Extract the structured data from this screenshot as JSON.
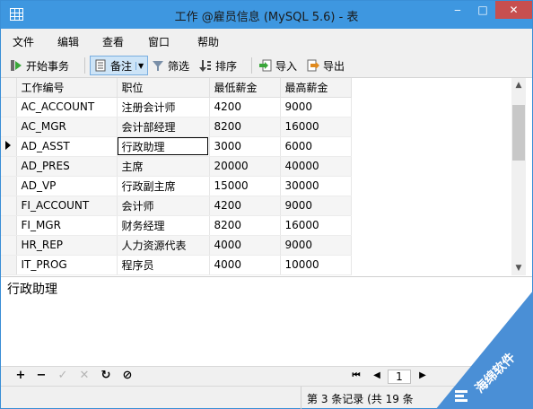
{
  "window": {
    "title": "工作 @雇员信息 (MySQL 5.6) - 表"
  },
  "menu": [
    "文件",
    "编辑",
    "查看",
    "窗口",
    "帮助"
  ],
  "toolbar": {
    "begin_transaction": "开始事务",
    "memo": "备注",
    "filter": "筛选",
    "sort": "排序",
    "import": "导入",
    "export": "导出"
  },
  "table": {
    "columns": [
      "工作编号",
      "职位",
      "最低薪金",
      "最高薪金"
    ],
    "rows": [
      [
        "AC_ACCOUNT",
        "注册会计师",
        "4200",
        "9000"
      ],
      [
        "AC_MGR",
        "会计部经理",
        "8200",
        "16000"
      ],
      [
        "AD_ASST",
        "行政助理",
        "3000",
        "6000"
      ],
      [
        "AD_PRES",
        "主席",
        "20000",
        "40000"
      ],
      [
        "AD_VP",
        "行政副主席",
        "15000",
        "30000"
      ],
      [
        "FI_ACCOUNT",
        "会计师",
        "4200",
        "9000"
      ],
      [
        "FI_MGR",
        "财务经理",
        "8200",
        "16000"
      ],
      [
        "HR_REP",
        "人力资源代表",
        "4000",
        "9000"
      ],
      [
        "IT_PROG",
        "程序员",
        "4000",
        "10000"
      ]
    ],
    "current_row": 3
  },
  "memo": {
    "text": "行政助理"
  },
  "nav": {
    "page": "1"
  },
  "status": {
    "record_text": "第 3 条记录 (共 19 条"
  },
  "watermark": {
    "text": "海绵软件"
  },
  "colors": {
    "titlebar": "#3e97e0",
    "selection": "#cde4f7",
    "watermark": "#4a8fd6"
  }
}
